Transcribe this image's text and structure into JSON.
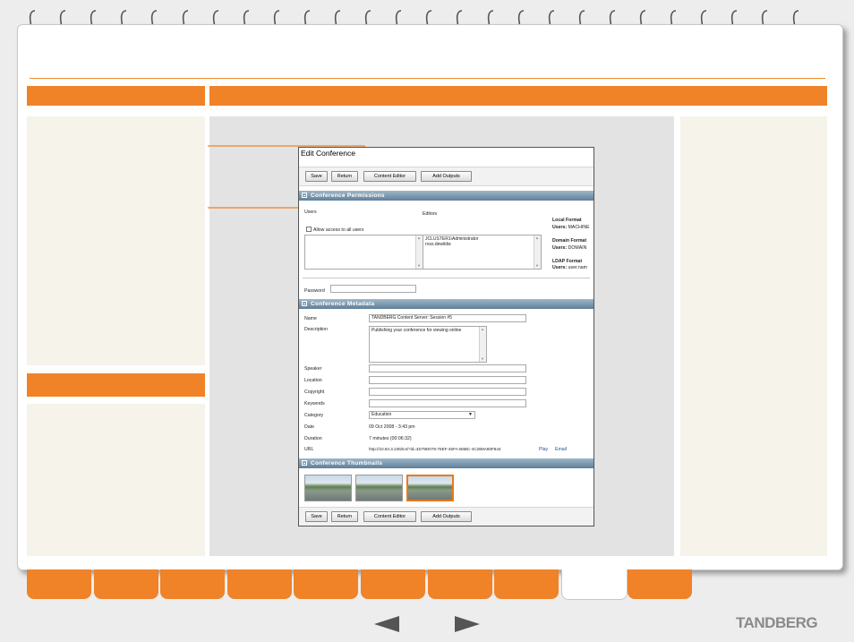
{
  "window": {
    "title": "Edit Conference",
    "toolbar": {
      "save": "Save",
      "return": "Return",
      "content_editor": "Content Editor",
      "add_outputs": "Add Outputs"
    }
  },
  "permissions": {
    "header": "Conference Permissions",
    "users_label": "Users",
    "editors_label": "Editors",
    "allow_all": "Allow access to all users",
    "editors_list": [
      "JCLUSTER1\\Administrator",
      "ross.dewildw"
    ],
    "local_format_title": "Local Format",
    "local_format_users_key": "Users:",
    "local_format_users_val": "MACHINE",
    "domain_format_title": "Domain Format",
    "domain_format_users_key": "Users:",
    "domain_format_users_val": "DOMAIN",
    "ldap_format_title": "LDAP Format",
    "ldap_format_users_key": "Users:",
    "ldap_format_users_val": "user.nam",
    "password_label": "Password"
  },
  "metadata": {
    "header": "Conference Metadata",
    "name_label": "Name",
    "name_value": "TANDBERG Content Server: Session #5",
    "description_label": "Description",
    "description_value": "Publishing your conference for viewing online",
    "speaker_label": "Speaker",
    "location_label": "Location",
    "copyright_label": "Copyright",
    "keywords_label": "Keywords",
    "category_label": "Category",
    "category_value": "Education",
    "date_label": "Date",
    "date_value": "09 Oct 2008 - 3:43 pm",
    "duration_label": "Duration",
    "duration_value": "7 minutes (00:06:32)",
    "url_label": "URL",
    "url_value": "http://10.84.3.236/tcs/?id=4D79D078-76EF-45FA-B6BC-4C2B9A80F844",
    "play_link": "Play",
    "email_link": "Email"
  },
  "thumbnails": {
    "header": "Conference Thumbnails",
    "count": 3,
    "selected_index": 2
  },
  "bottom_toolbar": {
    "save": "Save",
    "return": "Return",
    "content_editor": "Content Editor",
    "add_outputs": "Add Outputs"
  },
  "nav": {
    "tab_count": 10,
    "active_tab_index": 8,
    "prev": "previous-arrow-icon",
    "next": "next-arrow-icon"
  },
  "brand": {
    "logo": "TANDBERG",
    "accent": "#f08228"
  }
}
